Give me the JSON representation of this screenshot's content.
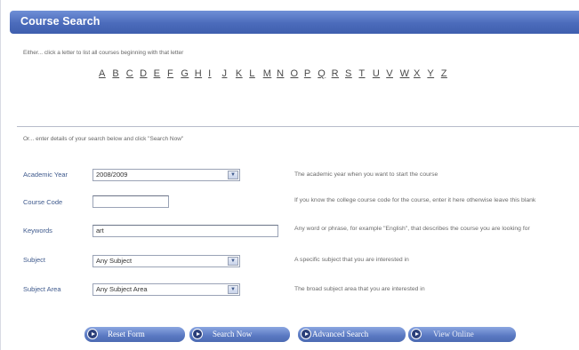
{
  "title": "Course Search",
  "intro_letters": "Either... click a letter to list all courses beginning with that letter",
  "letters": [
    "A",
    "B",
    "C",
    "D",
    "E",
    "F",
    "G",
    "H",
    "I",
    "J",
    "K",
    "L",
    "M",
    "N",
    "O",
    "P",
    "Q",
    "R",
    "S",
    "T",
    "U",
    "V",
    "W",
    "X",
    "Y",
    "Z"
  ],
  "intro_search": "Or... enter details of your search below and click \"Search Now\"",
  "fields": {
    "academic_year": {
      "label": "Academic Year",
      "value": "2008/2009",
      "help": "The academic year when you want to start the course"
    },
    "course_code": {
      "label": "Course Code",
      "value": "",
      "help": "If you know the college course code for the course, enter it here otherwise leave this blank"
    },
    "keywords": {
      "label": "Keywords",
      "value": "art",
      "help": "Any word or phrase, for example \"English\", that describes the course you are looking for"
    },
    "subject": {
      "label": "Subject",
      "value": "Any Subject",
      "help": "A specific subject that you are interested in"
    },
    "subject_area": {
      "label": "Subject Area",
      "value": "Any Subject Area",
      "help": "The broad subject area that you are interested in"
    }
  },
  "buttons": {
    "reset": "Reset Form",
    "search": "Search Now",
    "advanced": "Advanced Search",
    "view": "View Online"
  },
  "colors": {
    "title_bar": "#4b6bbb",
    "button": "#5a79c2",
    "label": "#3f5a8d"
  }
}
